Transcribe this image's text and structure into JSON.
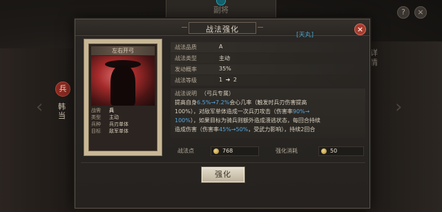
{
  "background": {
    "top_label": "副将",
    "help_icon": "?",
    "close_icon": "×",
    "badge_text": "兵",
    "left_side_text": "韩当",
    "right_side_text": "详情",
    "bottom_right_text": "",
    "colors": {
      "accent_blue": "#54a8e0",
      "close_red": "#a53b2e"
    }
  },
  "modal": {
    "title": "战法强化",
    "tag": "[天丸]",
    "close_glyph": "×",
    "card": {
      "name": "左右开弓",
      "info": [
        {
          "key": "战需",
          "val": "兵"
        },
        {
          "key": "类型",
          "val": "主动"
        },
        {
          "key": "兵种",
          "val": "兵刃单体"
        },
        {
          "key": "目标",
          "val": "敌军单体"
        }
      ]
    },
    "details": [
      {
        "key": "战法品质",
        "val": "A"
      },
      {
        "key": "战法类型",
        "val": "主动"
      },
      {
        "key": "发动概率",
        "val": "35%"
      },
      {
        "key": "战法等级",
        "val_from": "1",
        "val_arrow": "➔",
        "val_to": "2"
      }
    ],
    "description": {
      "head": "战法说明",
      "head_sub": "（弓兵专属）",
      "line1_a": "提高自身",
      "line1_hl": "6.5%→7.2%",
      "line1_b": "会心几率（触发时兵刃伤害提高",
      "line2_a": "100%），对敌军单体造成一次兵刃攻击（伤害率",
      "line2_hl": "90%→",
      "line3_hl": "100%",
      "line3_b": "），如果目标为骑兵则额外造成溃逃状态，每回合持续",
      "line4_a": "造成伤害（伤害率",
      "line4_hl": "45%→50%",
      "line4_b": "，受武力影响），持续2回合"
    },
    "stats": {
      "points_label": "战法点",
      "points_value": "768",
      "cost_label": "强化消耗",
      "cost_value": "50"
    },
    "enhance_button": "强化"
  }
}
